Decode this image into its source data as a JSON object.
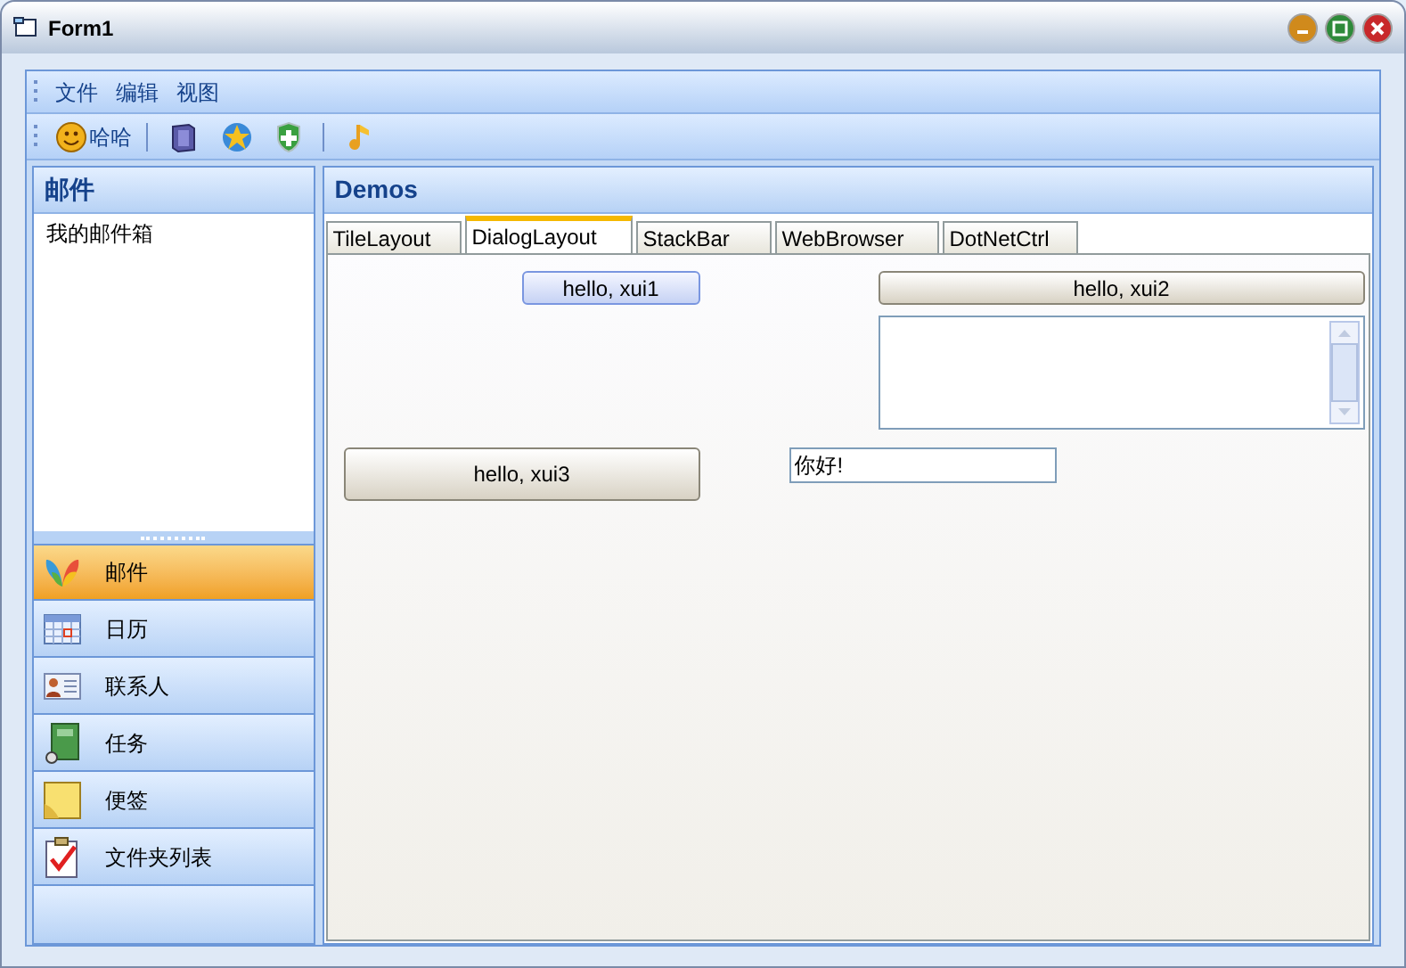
{
  "window": {
    "title": "Form1"
  },
  "menu": [
    "文件",
    "编辑",
    "视图"
  ],
  "toolbar": [
    {
      "kind": "button",
      "label": "哈哈"
    },
    {
      "kind": "separator"
    },
    {
      "kind": "icon"
    },
    {
      "kind": "icon"
    },
    {
      "kind": "icon"
    },
    {
      "kind": "separator"
    },
    {
      "kind": "icon"
    }
  ],
  "mail_pane": {
    "title": "邮件",
    "folders": [
      "我的邮件箱"
    ]
  },
  "nav_items": [
    {
      "label": "邮件",
      "selected": true
    },
    {
      "label": "日历",
      "selected": false
    },
    {
      "label": "联系人",
      "selected": false
    },
    {
      "label": "任务",
      "selected": false
    },
    {
      "label": "便签",
      "selected": false
    },
    {
      "label": "文件夹列表",
      "selected": false
    }
  ],
  "demos": {
    "title": "Demos",
    "tabs": [
      {
        "label": "TileLayout",
        "selected": false
      },
      {
        "label": "DialogLayout",
        "selected": true
      },
      {
        "label": "StackBar",
        "selected": false
      },
      {
        "label": "WebBrowser",
        "selected": false
      },
      {
        "label": "DotNetCtrl",
        "selected": false
      }
    ],
    "buttons": [
      {
        "label": "hello, xui1",
        "focused": true
      },
      {
        "label": "hello, xui2",
        "focused": false
      },
      {
        "label": "hello, xui3",
        "focused": false
      }
    ],
    "text_field": {
      "value": "你好!"
    }
  }
}
